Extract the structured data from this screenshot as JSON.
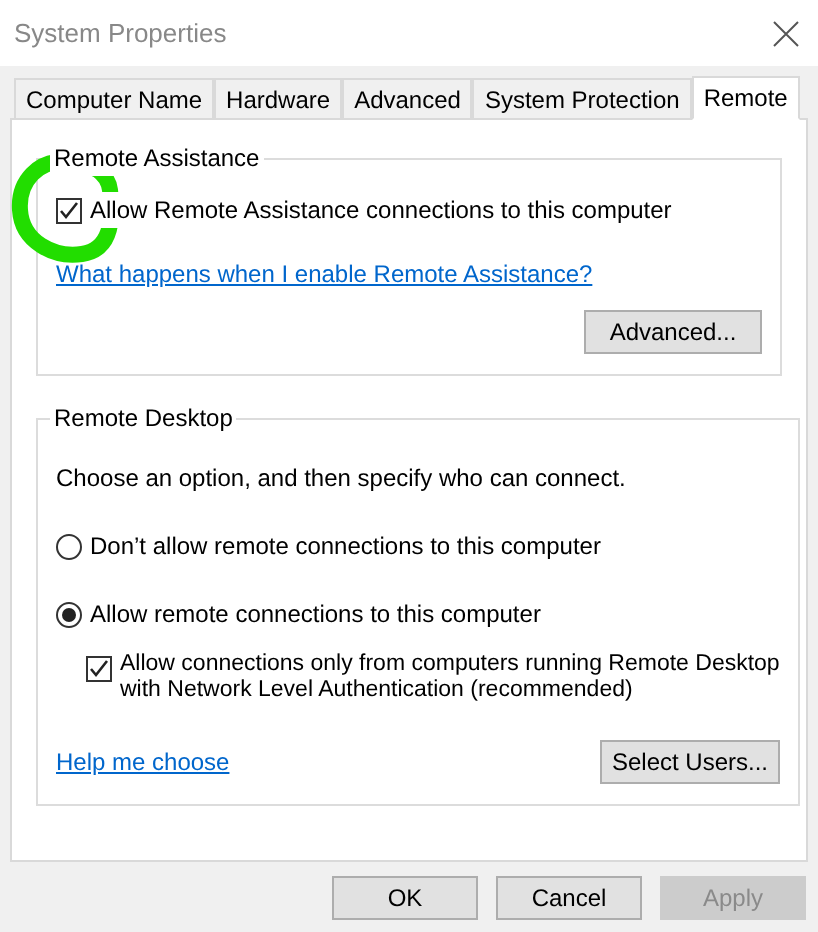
{
  "window": {
    "title": "System Properties"
  },
  "tabs": [
    {
      "label": "Computer Name",
      "selected": false
    },
    {
      "label": "Hardware",
      "selected": false
    },
    {
      "label": "Advanced",
      "selected": false
    },
    {
      "label": "System Protection",
      "selected": false
    },
    {
      "label": "Remote",
      "selected": true
    }
  ],
  "remote_assistance": {
    "title": "Remote Assistance",
    "checkbox": {
      "label": "Allow Remote Assistance connections to this computer",
      "checked": true
    },
    "link": "What happens when I enable Remote Assistance?",
    "button": "Advanced..."
  },
  "remote_desktop": {
    "title": "Remote Desktop",
    "instruction": "Choose an option, and then specify who can connect.",
    "options": [
      {
        "label": "Don’t allow remote connections to this computer",
        "selected": false
      },
      {
        "label": "Allow remote connections to this computer",
        "selected": true
      }
    ],
    "nla_checkbox": {
      "label": "Allow connections only from computers running Remote Desktop with Network Level Authentication (recommended)",
      "checked": true
    },
    "link": "Help me choose",
    "button": "Select Users..."
  },
  "buttons": [
    {
      "label": "OK",
      "disabled": false
    },
    {
      "label": "Cancel",
      "disabled": false
    },
    {
      "label": "Apply",
      "disabled": true
    }
  ]
}
